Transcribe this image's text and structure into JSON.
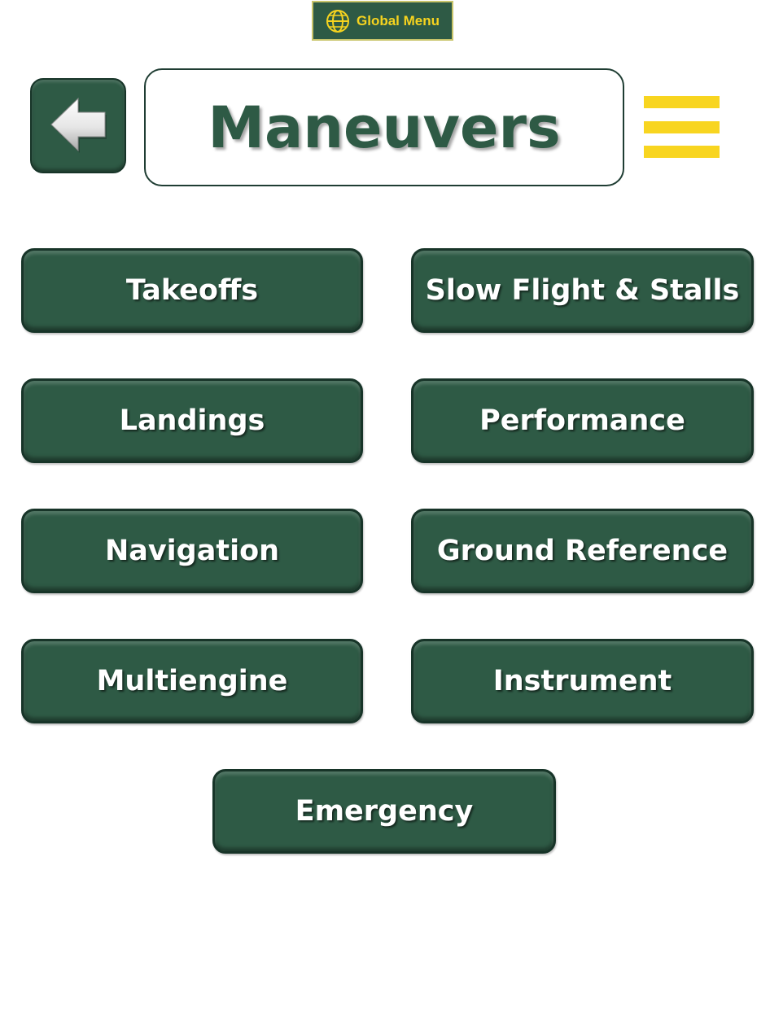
{
  "global_menu": {
    "label": "Global Menu",
    "icon": "globe-icon"
  },
  "header": {
    "title": "Maneuvers",
    "back_icon": "arrow-left-icon",
    "menu_icon": "hamburger-icon"
  },
  "colors": {
    "primary_green": "#2e5a45",
    "accent_yellow": "#f8d520",
    "button_text": "#ffffff"
  },
  "menu": {
    "items": [
      {
        "label": "Takeoffs"
      },
      {
        "label": "Slow Flight & Stalls"
      },
      {
        "label": "Landings"
      },
      {
        "label": "Performance"
      },
      {
        "label": "Navigation"
      },
      {
        "label": "Ground Reference"
      },
      {
        "label": "Multiengine"
      },
      {
        "label": "Instrument"
      },
      {
        "label": "Emergency"
      }
    ]
  }
}
